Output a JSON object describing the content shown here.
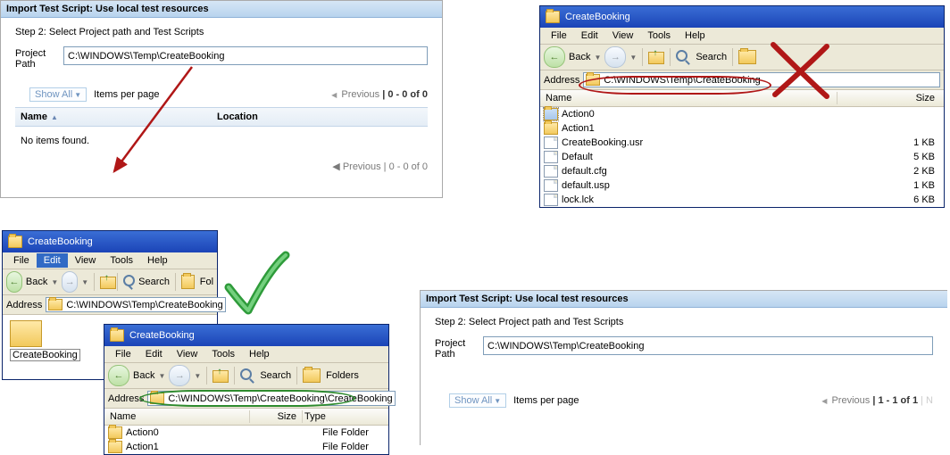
{
  "import1": {
    "header": "Import Test Script: Use local test resources",
    "step": "Step 2: Select Project path and Test Scripts",
    "pp_label_l1": "Project",
    "pp_label_l2": "Path",
    "pp_value": "C:\\WINDOWS\\Temp\\CreateBooking",
    "showall": "Show All",
    "ipp": "Items per page",
    "prev_label": "Previous",
    "pagerange": "| 0 - 0 of 0",
    "col_name": "Name",
    "col_loc": "Location",
    "noitems": "No items found."
  },
  "import2": {
    "header": "Import Test Script: Use local test resources",
    "step": "Step 2: Select Project path and Test Scripts",
    "pp_label_l1": "Project",
    "pp_label_l2": "Path",
    "pp_value": "C:\\WINDOWS\\Temp\\CreateBooking",
    "showall": "Show All",
    "ipp": "Items per page",
    "prev_label": "Previous",
    "pagerange": "| 1 - 1 of 1"
  },
  "xp_common": {
    "menu_file": "File",
    "menu_edit": "Edit",
    "menu_view": "View",
    "menu_tools": "Tools",
    "menu_help": "Help",
    "back": "Back",
    "search": "Search",
    "folders": "Folders",
    "address": "Address",
    "col_name": "Name",
    "col_size": "Size",
    "col_type": "Type"
  },
  "win_tr": {
    "title": "CreateBooking",
    "addr": "C:\\WINDOWS\\Temp\\CreateBooking",
    "files": [
      {
        "name": "Action0",
        "icon": "fold",
        "size": "",
        "sel": true
      },
      {
        "name": "Action1",
        "icon": "fold",
        "size": ""
      },
      {
        "name": "CreateBooking.usr",
        "icon": "file",
        "size": "1 KB"
      },
      {
        "name": "Default",
        "icon": "file",
        "size": "5 KB"
      },
      {
        "name": "default.cfg",
        "icon": "file",
        "size": "2 KB"
      },
      {
        "name": "default.usp",
        "icon": "file",
        "size": "1 KB"
      },
      {
        "name": "lock.lck",
        "icon": "file",
        "size": "6 KB"
      }
    ]
  },
  "win_bl1": {
    "title": "CreateBooking",
    "addr": "C:\\WINDOWS\\Temp\\CreateBooking",
    "files": [
      {
        "name": "CreateBooking",
        "icon": "fold",
        "size": ""
      }
    ]
  },
  "win_bl2": {
    "title": "CreateBooking",
    "addr": "C:\\WINDOWS\\Temp\\CreateBooking\\CreateBooking",
    "files": [
      {
        "name": "Action0",
        "icon": "fold",
        "size": "",
        "type": "File Folder"
      },
      {
        "name": "Action1",
        "icon": "fold",
        "size": "",
        "type": "File Folder"
      }
    ]
  }
}
